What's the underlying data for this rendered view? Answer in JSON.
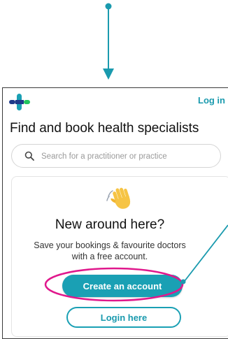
{
  "header": {
    "login_label": "Log in"
  },
  "main": {
    "heading": "Find and book health specialists",
    "search": {
      "placeholder": "Search for a practitioner or practice"
    }
  },
  "card": {
    "title": "New around here?",
    "text": "Save your bookings & favourite doctors with a free account.",
    "create_label": "Create an account",
    "login_label": "Login here"
  },
  "colors": {
    "accent": "#1aa0b4",
    "highlight": "#e0188c",
    "logo_blue": "#1e3a8a",
    "logo_teal": "#1aa0b4",
    "logo_green": "#22c55e"
  },
  "icons": [
    "search-icon",
    "waving-hand-icon",
    "logo-icon"
  ]
}
